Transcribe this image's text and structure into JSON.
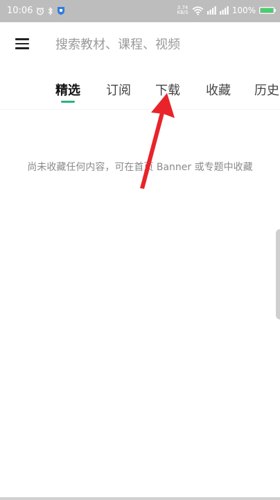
{
  "status_bar": {
    "time": "10:06",
    "net_speed_top": "3.74",
    "net_speed_bottom": "KB/S",
    "battery_text": "100%",
    "battery_level": 1.0
  },
  "search": {
    "placeholder": "搜索教材、课程、视频"
  },
  "tabs": [
    {
      "label": "精选",
      "active": true
    },
    {
      "label": "订阅"
    },
    {
      "label": "下载"
    },
    {
      "label": "收藏"
    },
    {
      "label": "历史"
    }
  ],
  "content": {
    "empty_message": "尚未收藏任何内容，可在首页 Banner 或专题中收藏"
  },
  "colors": {
    "accent": "#29b37a",
    "annotation_arrow": "#e8242a"
  }
}
